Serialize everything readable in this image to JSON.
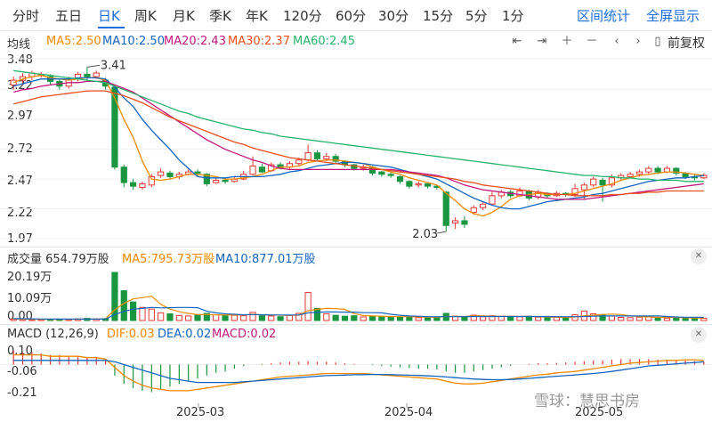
{
  "tabs": [
    "分时",
    "五日",
    "日K",
    "周K",
    "月K",
    "季K",
    "年K",
    "120分",
    "60分",
    "30分",
    "15分",
    "5分",
    "1分"
  ],
  "active_tab": "日K",
  "right_links": {
    "interval_stats": "区间统计",
    "fullscreen": "全屏显示"
  },
  "ma_row": {
    "label": "均线",
    "ma5": "MA5:2.50",
    "ma10": "MA10:2.50",
    "ma20": "MA20:2.43",
    "ma30": "MA30:2.37",
    "ma60": "MA60:2.45"
  },
  "adjust_label": "前复权",
  "price_axis": [
    "3.48",
    "3.22",
    "2.97",
    "2.72",
    "2.47",
    "2.22",
    "1.97"
  ],
  "high_label": "3.41",
  "low_label": "2.03",
  "vol_row": {
    "label": "成交量 654.79万股",
    "ma5": "MA5:795.73万股",
    "ma10": "MA10:877.01万股"
  },
  "vol_axis": [
    "20.19万",
    "10.09万",
    "0.00"
  ],
  "macd_row": {
    "label": "MACD (12,26,9)",
    "dif": "DIF:0.03",
    "dea": "DEA:0.02",
    "macd": "MACD:0.02"
  },
  "macd_axis": [
    "0.10",
    "-0.06",
    "-0.21"
  ],
  "dates": [
    "2025-03",
    "2025-04",
    "2025-05"
  ],
  "watermark": "雪球：慧思书房",
  "colors": {
    "up": "#e53935",
    "down": "#1a9641",
    "ma5": "#f08a00",
    "ma10": "#1565c0",
    "ma20": "#c2187e",
    "ma30": "#e8501e",
    "ma60": "#27b36a",
    "accent": "#1e6fd9"
  },
  "chart_data": {
    "type": "candlestick",
    "price_ylim": [
      1.97,
      3.48
    ],
    "candles": [
      [
        3.26,
        3.3,
        3.22,
        3.33
      ],
      [
        3.3,
        3.33,
        3.26,
        3.36
      ],
      [
        3.33,
        3.36,
        3.3,
        3.38
      ],
      [
        3.34,
        3.35,
        3.32,
        3.37
      ],
      [
        3.33,
        3.29,
        3.26,
        3.35
      ],
      [
        3.29,
        3.25,
        3.22,
        3.31
      ],
      [
        3.25,
        3.31,
        3.23,
        3.33
      ],
      [
        3.31,
        3.35,
        3.29,
        3.37
      ],
      [
        3.35,
        3.33,
        3.3,
        3.41
      ],
      [
        3.33,
        3.36,
        3.31,
        3.38
      ],
      [
        3.3,
        3.25,
        3.22,
        3.32
      ],
      [
        3.24,
        2.57,
        2.55,
        3.26
      ],
      [
        2.57,
        2.44,
        2.4,
        2.59
      ],
      [
        2.44,
        2.41,
        2.38,
        2.47
      ],
      [
        2.4,
        2.43,
        2.38,
        2.45
      ],
      [
        2.42,
        2.49,
        2.4,
        2.51
      ],
      [
        2.5,
        2.53,
        2.48,
        2.56
      ],
      [
        2.52,
        2.49,
        2.47,
        2.54
      ],
      [
        2.49,
        2.51,
        2.47,
        2.53
      ],
      [
        2.51,
        2.53,
        2.5,
        2.55
      ],
      [
        2.53,
        2.52,
        2.49,
        2.55
      ],
      [
        2.51,
        2.43,
        2.41,
        2.52
      ],
      [
        2.44,
        2.46,
        2.43,
        2.48
      ],
      [
        2.46,
        2.45,
        2.43,
        2.47
      ],
      [
        2.45,
        2.47,
        2.44,
        2.49
      ],
      [
        2.47,
        2.51,
        2.46,
        2.54
      ],
      [
        2.51,
        2.58,
        2.5,
        2.66
      ],
      [
        2.57,
        2.53,
        2.52,
        2.6
      ],
      [
        2.54,
        2.59,
        2.53,
        2.61
      ],
      [
        2.59,
        2.56,
        2.55,
        2.61
      ],
      [
        2.57,
        2.6,
        2.55,
        2.62
      ],
      [
        2.6,
        2.63,
        2.58,
        2.65
      ],
      [
        2.63,
        2.69,
        2.62,
        2.76
      ],
      [
        2.69,
        2.64,
        2.62,
        2.71
      ],
      [
        2.64,
        2.66,
        2.62,
        2.69
      ],
      [
        2.66,
        2.62,
        2.6,
        2.68
      ],
      [
        2.62,
        2.59,
        2.57,
        2.63
      ],
      [
        2.59,
        2.56,
        2.54,
        2.6
      ],
      [
        2.56,
        2.57,
        2.54,
        2.59
      ],
      [
        2.57,
        2.52,
        2.5,
        2.58
      ],
      [
        2.53,
        2.51,
        2.49,
        2.54
      ],
      [
        2.51,
        2.5,
        2.48,
        2.53
      ],
      [
        2.49,
        2.45,
        2.43,
        2.5
      ],
      [
        2.45,
        2.41,
        2.39,
        2.46
      ],
      [
        2.42,
        2.43,
        2.4,
        2.45
      ],
      [
        2.43,
        2.41,
        2.39,
        2.44
      ],
      [
        2.41,
        2.4,
        2.38,
        2.42
      ],
      [
        2.36,
        2.08,
        2.03,
        2.37
      ],
      [
        2.1,
        2.12,
        2.05,
        2.15
      ],
      [
        2.12,
        2.09,
        2.06,
        2.16
      ],
      [
        2.19,
        2.23,
        2.17,
        2.25
      ],
      [
        2.23,
        2.26,
        2.21,
        2.28
      ],
      [
        2.26,
        2.33,
        2.25,
        2.37
      ],
      [
        2.33,
        2.36,
        2.31,
        2.38
      ],
      [
        2.36,
        2.33,
        2.31,
        2.38
      ],
      [
        2.33,
        2.37,
        2.32,
        2.4
      ],
      [
        2.37,
        2.31,
        2.29,
        2.38
      ],
      [
        2.32,
        2.36,
        2.3,
        2.38
      ],
      [
        2.35,
        2.33,
        2.31,
        2.36
      ],
      [
        2.33,
        2.35,
        2.32,
        2.37
      ],
      [
        2.35,
        2.34,
        2.32,
        2.36
      ],
      [
        2.34,
        2.39,
        2.32,
        2.43
      ],
      [
        2.38,
        2.42,
        2.3,
        2.44
      ],
      [
        2.42,
        2.47,
        2.4,
        2.49
      ],
      [
        2.46,
        2.42,
        2.28,
        2.48
      ],
      [
        2.42,
        2.48,
        2.4,
        2.51
      ],
      [
        2.48,
        2.5,
        2.46,
        2.52
      ],
      [
        2.49,
        2.51,
        2.48,
        2.53
      ],
      [
        2.51,
        2.53,
        2.49,
        2.55
      ],
      [
        2.53,
        2.56,
        2.51,
        2.58
      ],
      [
        2.56,
        2.53,
        2.51,
        2.58
      ],
      [
        2.53,
        2.56,
        2.52,
        2.58
      ],
      [
        2.56,
        2.52,
        2.5,
        2.57
      ],
      [
        2.52,
        2.49,
        2.47,
        2.53
      ],
      [
        2.49,
        2.48,
        2.46,
        2.51
      ],
      [
        2.48,
        2.5,
        2.47,
        2.52
      ]
    ],
    "ma_series": {
      "ma5": [
        3.28,
        3.31,
        3.33,
        3.34,
        3.32,
        3.31,
        3.3,
        3.31,
        3.32,
        3.32,
        3.3,
        3.15,
        2.97,
        2.82,
        2.62,
        2.47,
        2.46,
        2.47,
        2.49,
        2.51,
        2.51,
        2.5,
        2.49,
        2.47,
        2.47,
        2.48,
        2.49,
        2.51,
        2.54,
        2.57,
        2.57,
        2.58,
        2.61,
        2.62,
        2.63,
        2.63,
        2.62,
        2.61,
        2.6,
        2.57,
        2.55,
        2.53,
        2.51,
        2.48,
        2.46,
        2.44,
        2.42,
        2.35,
        2.29,
        2.22,
        2.18,
        2.16,
        2.19,
        2.24,
        2.3,
        2.33,
        2.34,
        2.35,
        2.34,
        2.34,
        2.34,
        2.35,
        2.37,
        2.39,
        2.41,
        2.43,
        2.46,
        2.48,
        2.5,
        2.51,
        2.52,
        2.53,
        2.53,
        2.52,
        2.51,
        2.5
      ],
      "ma10": [
        3.25,
        3.27,
        3.29,
        3.31,
        3.31,
        3.31,
        3.31,
        3.32,
        3.32,
        3.32,
        3.31,
        3.24,
        3.15,
        3.08,
        2.97,
        2.88,
        2.8,
        2.72,
        2.63,
        2.56,
        2.49,
        2.48,
        2.48,
        2.48,
        2.49,
        2.49,
        2.49,
        2.49,
        2.5,
        2.51,
        2.53,
        2.54,
        2.56,
        2.58,
        2.59,
        2.6,
        2.61,
        2.61,
        2.6,
        2.59,
        2.58,
        2.57,
        2.55,
        2.53,
        2.51,
        2.49,
        2.47,
        2.43,
        2.39,
        2.35,
        2.31,
        2.28,
        2.25,
        2.23,
        2.22,
        2.22,
        2.24,
        2.26,
        2.28,
        2.29,
        2.3,
        2.31,
        2.32,
        2.34,
        2.35,
        2.37,
        2.39,
        2.41,
        2.43,
        2.45,
        2.46,
        2.47,
        2.48,
        2.48,
        2.49,
        2.5
      ],
      "ma20": [
        3.2,
        3.22,
        3.23,
        3.25,
        3.26,
        3.27,
        3.28,
        3.28,
        3.29,
        3.29,
        3.29,
        3.26,
        3.23,
        3.2,
        3.15,
        3.1,
        3.05,
        3.0,
        2.95,
        2.9,
        2.85,
        2.8,
        2.76,
        2.72,
        2.69,
        2.66,
        2.63,
        2.61,
        2.58,
        2.56,
        2.55,
        2.55,
        2.55,
        2.55,
        2.55,
        2.55,
        2.55,
        2.55,
        2.55,
        2.55,
        2.55,
        2.55,
        2.54,
        2.53,
        2.52,
        2.51,
        2.5,
        2.48,
        2.45,
        2.42,
        2.4,
        2.38,
        2.37,
        2.36,
        2.35,
        2.34,
        2.33,
        2.32,
        2.31,
        2.3,
        2.3,
        2.3,
        2.3,
        2.31,
        2.32,
        2.33,
        2.34,
        2.35,
        2.36,
        2.37,
        2.38,
        2.39,
        2.4,
        2.41,
        2.42,
        2.43
      ],
      "ma30": [
        3.1,
        3.12,
        3.14,
        3.16,
        3.17,
        3.18,
        3.19,
        3.2,
        3.21,
        3.21,
        3.21,
        3.19,
        3.17,
        3.14,
        3.11,
        3.07,
        3.03,
        2.99,
        2.96,
        2.93,
        2.9,
        2.87,
        2.84,
        2.81,
        2.78,
        2.76,
        2.73,
        2.71,
        2.69,
        2.67,
        2.65,
        2.64,
        2.63,
        2.62,
        2.61,
        2.6,
        2.59,
        2.58,
        2.57,
        2.56,
        2.55,
        2.54,
        2.53,
        2.52,
        2.51,
        2.5,
        2.49,
        2.48,
        2.47,
        2.45,
        2.44,
        2.42,
        2.41,
        2.4,
        2.39,
        2.38,
        2.37,
        2.36,
        2.35,
        2.34,
        2.34,
        2.33,
        2.33,
        2.33,
        2.33,
        2.34,
        2.34,
        2.35,
        2.35,
        2.36,
        2.36,
        2.37,
        2.37,
        2.37,
        2.37,
        2.37
      ],
      "ma60": [
        3.38,
        3.37,
        3.36,
        3.35,
        3.34,
        3.33,
        3.32,
        3.31,
        3.3,
        3.29,
        3.28,
        3.25,
        3.22,
        3.19,
        3.16,
        3.13,
        3.1,
        3.07,
        3.04,
        3.02,
        2.99,
        2.97,
        2.95,
        2.93,
        2.91,
        2.89,
        2.88,
        2.86,
        2.85,
        2.83,
        2.82,
        2.81,
        2.8,
        2.79,
        2.78,
        2.77,
        2.76,
        2.75,
        2.74,
        2.73,
        2.72,
        2.71,
        2.7,
        2.69,
        2.68,
        2.67,
        2.66,
        2.65,
        2.64,
        2.63,
        2.62,
        2.61,
        2.6,
        2.59,
        2.58,
        2.57,
        2.56,
        2.55,
        2.54,
        2.53,
        2.52,
        2.51,
        2.5,
        2.5,
        2.49,
        2.49,
        2.48,
        2.48,
        2.47,
        2.47,
        2.46,
        2.46,
        2.46,
        2.45,
        2.45,
        2.45
      ]
    },
    "volume_ylim": [
      0,
      20.19
    ],
    "volume": [
      0.6,
      0.5,
      0.4,
      0.5,
      0.4,
      0.6,
      0.5,
      0.7,
      0.9,
      0.6,
      0.8,
      20.19,
      12.5,
      7.8,
      5.5,
      4.8,
      3.2,
      2.8,
      2.1,
      1.9,
      2.5,
      3.0,
      2.4,
      2.0,
      2.2,
      2.0,
      3.4,
      2.0,
      1.9,
      1.6,
      2.1,
      3.0,
      11.8,
      5.1,
      2.8,
      2.2,
      1.8,
      2.0,
      1.5,
      1.9,
      1.8,
      1.5,
      1.4,
      1.8,
      1.2,
      1.1,
      1.3,
      3.0,
      1.8,
      1.5,
      2.2,
      1.6,
      2.0,
      1.7,
      1.5,
      1.6,
      1.8,
      1.4,
      1.2,
      1.3,
      1.0,
      2.4,
      4.0,
      2.8,
      2.5,
      1.9,
      1.3,
      1.2,
      1.4,
      1.5,
      1.2,
      1.0,
      1.3,
      1.2,
      1.0,
      0.9
    ],
    "vol_ma5": [
      0.7,
      0.6,
      0.55,
      0.5,
      0.5,
      0.5,
      0.5,
      0.55,
      0.6,
      0.65,
      0.7,
      4.5,
      7.2,
      9.1,
      9.6,
      10.2,
      6.8,
      4.8,
      3.7,
      3.0,
      2.5,
      2.5,
      2.4,
      2.3,
      2.4,
      2.3,
      2.6,
      2.4,
      2.3,
      2.2,
      2.2,
      2.2,
      4.1,
      4.7,
      5.1,
      5.0,
      4.7,
      2.9,
      2.1,
      1.9,
      1.8,
      1.7,
      1.6,
      1.6,
      1.5,
      1.4,
      1.4,
      1.7,
      1.7,
      1.7,
      2.0,
      2.0,
      1.8,
      1.8,
      1.8,
      1.7,
      1.7,
      1.6,
      1.5,
      1.4,
      1.3,
      1.5,
      2.0,
      2.2,
      2.5,
      2.7,
      2.5,
      1.9,
      1.6,
      1.5,
      1.3,
      1.3,
      1.3,
      1.2,
      1.1,
      1.1
    ],
    "vol_ma10": [
      0.8,
      0.75,
      0.7,
      0.65,
      0.6,
      0.6,
      0.58,
      0.58,
      0.58,
      0.58,
      0.6,
      2.5,
      3.8,
      4.8,
      5.1,
      5.5,
      5.3,
      5.4,
      5.5,
      5.5,
      5.4,
      3.9,
      3.2,
      2.8,
      2.6,
      2.4,
      2.5,
      2.4,
      2.3,
      2.3,
      2.3,
      2.3,
      3.2,
      3.4,
      3.6,
      3.6,
      3.5,
      3.5,
      3.3,
      3.3,
      3.2,
      2.6,
      2.2,
      1.9,
      1.8,
      1.6,
      1.6,
      1.6,
      1.6,
      1.6,
      1.7,
      1.7,
      1.7,
      1.7,
      1.7,
      1.7,
      1.7,
      1.7,
      1.7,
      1.6,
      1.6,
      1.6,
      1.7,
      1.8,
      1.9,
      1.9,
      1.9,
      1.9,
      1.9,
      1.9,
      1.9,
      1.7,
      1.5,
      1.4,
      1.4,
      1.3
    ],
    "macd_ylim": [
      -0.21,
      0.1
    ],
    "macd_hist": [
      0.1,
      0.09,
      0.09,
      0.08,
      0.07,
      0.07,
      0.06,
      0.06,
      0.05,
      0.05,
      0.04,
      -0.08,
      -0.14,
      -0.17,
      -0.19,
      -0.2,
      -0.18,
      -0.16,
      -0.14,
      -0.12,
      -0.1,
      -0.08,
      -0.06,
      -0.05,
      -0.03,
      -0.01,
      0.0,
      0.005,
      0.01,
      0.015,
      0.02,
      0.02,
      0.025,
      0.02,
      0.02,
      0.015,
      0.01,
      0.005,
      0.0,
      -0.005,
      -0.01,
      -0.015,
      -0.02,
      -0.025,
      -0.03,
      -0.03,
      -0.035,
      -0.05,
      -0.06,
      -0.06,
      -0.05,
      -0.04,
      -0.03,
      -0.02,
      -0.01,
      0.0,
      0.005,
      0.01,
      0.01,
      0.012,
      0.015,
      0.02,
      0.025,
      0.03,
      0.03,
      0.035,
      0.04,
      0.04,
      0.04,
      0.04,
      0.035,
      0.035,
      0.03,
      0.03,
      0.025,
      0.02
    ],
    "dif": [
      0.07,
      0.07,
      0.07,
      0.07,
      0.06,
      0.06,
      0.06,
      0.06,
      0.05,
      0.05,
      0.04,
      -0.02,
      -0.08,
      -0.12,
      -0.15,
      -0.17,
      -0.18,
      -0.19,
      -0.19,
      -0.19,
      -0.18,
      -0.17,
      -0.16,
      -0.15,
      -0.14,
      -0.13,
      -0.12,
      -0.11,
      -0.1,
      -0.09,
      -0.085,
      -0.08,
      -0.075,
      -0.07,
      -0.065,
      -0.065,
      -0.065,
      -0.065,
      -0.065,
      -0.07,
      -0.075,
      -0.08,
      -0.085,
      -0.09,
      -0.095,
      -0.1,
      -0.105,
      -0.12,
      -0.135,
      -0.14,
      -0.14,
      -0.135,
      -0.125,
      -0.115,
      -0.105,
      -0.095,
      -0.085,
      -0.075,
      -0.07,
      -0.06,
      -0.055,
      -0.05,
      -0.04,
      -0.03,
      -0.02,
      -0.01,
      0.0,
      0.01,
      0.015,
      0.02,
      0.025,
      0.03,
      0.03,
      0.035,
      0.035,
      0.03
    ],
    "dea": [
      0.03,
      0.03,
      0.03,
      0.03,
      0.03,
      0.03,
      0.03,
      0.03,
      0.03,
      0.03,
      0.03,
      0.02,
      0.0,
      -0.02,
      -0.04,
      -0.06,
      -0.08,
      -0.1,
      -0.11,
      -0.12,
      -0.13,
      -0.13,
      -0.13,
      -0.13,
      -0.13,
      -0.125,
      -0.12,
      -0.115,
      -0.11,
      -0.105,
      -0.1,
      -0.095,
      -0.09,
      -0.085,
      -0.08,
      -0.078,
      -0.076,
      -0.074,
      -0.073,
      -0.072,
      -0.072,
      -0.073,
      -0.075,
      -0.077,
      -0.079,
      -0.082,
      -0.085,
      -0.09,
      -0.095,
      -0.1,
      -0.105,
      -0.108,
      -0.11,
      -0.11,
      -0.108,
      -0.105,
      -0.1,
      -0.095,
      -0.09,
      -0.085,
      -0.08,
      -0.075,
      -0.07,
      -0.065,
      -0.058,
      -0.05,
      -0.04,
      -0.03,
      -0.02,
      -0.01,
      -0.005,
      0.0,
      0.005,
      0.01,
      0.015,
      0.02
    ]
  }
}
